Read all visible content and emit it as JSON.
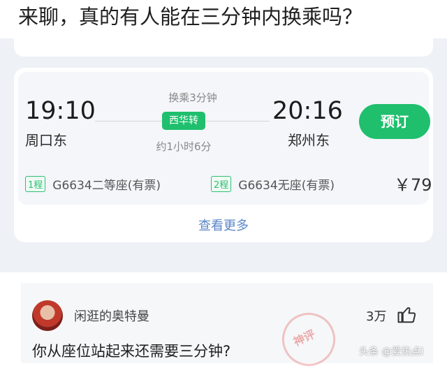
{
  "post_title": "来聊，真的有人能在三分钟内换乘吗？",
  "train_card": {
    "departure_time": "19:10",
    "departure_station": "周口东",
    "arrival_time": "20:16",
    "arrival_station": "郑州东",
    "transfer_info": "换乘3分钟",
    "transfer_station_badge": "西华转",
    "duration": "约1小时6分",
    "book_button": "预订",
    "legs": [
      {
        "tag": "1程",
        "text": "G6634二等座(有票)"
      },
      {
        "tag": "2程",
        "text": "G6634无座(有票)"
      }
    ],
    "price": "￥79",
    "more_link": "查看更多",
    "accent_color": "#1fbf6d"
  },
  "comment": {
    "username": "闲逛的奥特曼",
    "likes": "3万",
    "text": "你从座位站起来还需要三分钟?",
    "stamp_text": "神评",
    "avatar_icon": "avatar"
  },
  "watermark": "头条 @爱热点i"
}
